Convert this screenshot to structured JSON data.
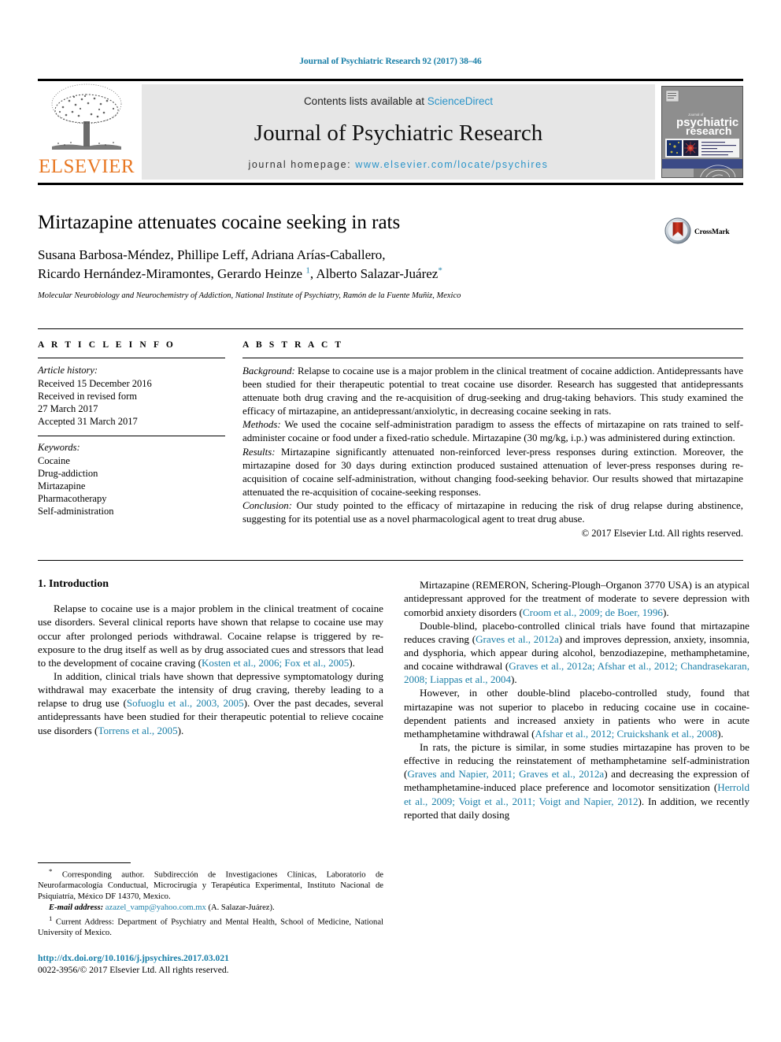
{
  "running_head": "Journal of Psychiatric Research 92 (2017) 38–46",
  "masthead": {
    "contents_prefix": "Contents lists available at ",
    "sciencedirect": "ScienceDirect",
    "journal_title": "Journal of Psychiatric Research",
    "homepage_label": "journal homepage: ",
    "homepage_url": "www.elsevier.com/locate/psychires",
    "publisher_logo_text": "ELSEVIER",
    "publisher_logo_icon": "elsevier-tree-icon",
    "cover_title_small": "Journal of",
    "cover_title_line1": "psychiatric",
    "cover_title_line2": "research",
    "accent_link_color": "#2a94c9",
    "elsevier_orange": "#E87722"
  },
  "article": {
    "title": "Mirtazapine attenuates cocaine seeking in rats",
    "authors_line1": "Susana Barbosa-Méndez, Phillipe Leff, Adriana Arías-Caballero,",
    "authors_line2_a": "Ricardo Hernández-Miramontes, Gerardo Heinze ",
    "authors_line2_mark1": "1",
    "authors_line2_b": ", Alberto Salazar-Juárez",
    "authors_line2_mark2": "*",
    "affiliation": "Molecular Neurobiology and Neurochemistry of Addiction, National Institute of Psychiatry, Ramón de la Fuente Muñiz, Mexico",
    "crossmark_label": "CrossMark",
    "crossmark_icon": "crossmark-icon"
  },
  "article_info": {
    "section_label": "A R T I C L E   I N F O",
    "history_head": "Article history:",
    "history": [
      "Received 15 December 2016",
      "Received in revised form",
      "27 March 2017",
      "Accepted 31 March 2017"
    ],
    "keywords_head": "Keywords:",
    "keywords": [
      "Cocaine",
      "Drug-addiction",
      "Mirtazapine",
      "Pharmacotherapy",
      "Self-administration"
    ]
  },
  "abstract": {
    "section_label": "A B S T R A C T",
    "background_label": "Background:",
    "background_text": " Relapse to cocaine use is a major problem in the clinical treatment of cocaine addiction. Antidepressants have been studied for their therapeutic potential to treat cocaine use disorder. Research has suggested that antidepressants attenuate both drug craving and the re-acquisition of drug-seeking and drug-taking behaviors. This study examined the efficacy of mirtazapine, an antidepressant/anxiolytic, in decreasing cocaine seeking in rats.",
    "methods_label": "Methods:",
    "methods_text": " We used the cocaine self-administration paradigm to assess the effects of mirtazapine on rats trained to self-administer cocaine or food under a fixed-ratio schedule. Mirtazapine (30 mg/kg, i.p.) was administered during extinction.",
    "results_label": "Results:",
    "results_text": " Mirtazapine significantly attenuated non-reinforced lever-press responses during extinction. Moreover, the mirtazapine dosed for 30 days during extinction produced sustained attenuation of lever-press responses during re-acquisition of cocaine self-administration, without changing food-seeking behavior. Our results showed that mirtazapine attenuated the re-acquisition of cocaine-seeking responses.",
    "conclusion_label": "Conclusion:",
    "conclusion_text": " Our study pointed to the efficacy of mirtazapine in reducing the risk of drug relapse during abstinence, suggesting for its potential use as a novel pharmacological agent to treat drug abuse.",
    "copyright": "© 2017 Elsevier Ltd. All rights reserved."
  },
  "introduction": {
    "heading": "1. Introduction",
    "left_para1_a": "Relapse to cocaine use is a major problem in the clinical treatment of cocaine use disorders. Several clinical reports have shown that relapse to cocaine use may occur after prolonged periods withdrawal. Cocaine relapse is triggered by re-exposure to the drug itself as well as by drug associated cues and stressors that lead to the development of cocaine craving (",
    "left_para1_ref": "Kosten et al., 2006; Fox et al., 2005",
    "left_para1_b": ").",
    "left_para2_a": "In addition, clinical trials have shown that depressive symptomatology during withdrawal may exacerbate the intensity of drug craving, thereby leading to a relapse to drug use (",
    "left_para2_ref1": "Sofuoglu et al., 2003, 2005",
    "left_para2_b": "). Over the past decades, several antidepressants have been studied for their therapeutic potential to relieve cocaine use disorders (",
    "left_para2_ref2": "Torrens et al., 2005",
    "left_para2_c": ").",
    "right_para1_a": "Mirtazapine (REMERON, Schering-Plough–Organon 3770 USA) is an atypical antidepressant approved for the treatment of moderate to severe depression with comorbid anxiety disorders (",
    "right_para1_ref": "Croom et al., 2009; de Boer, 1996",
    "right_para1_b": ").",
    "right_para2_a": "Double-blind, placebo-controlled clinical trials have found that mirtazapine reduces craving (",
    "right_para2_ref1": "Graves et al., 2012a",
    "right_para2_b": ") and improves depression, anxiety, insomnia, and dysphoria, which appear during alcohol, benzodiazepine, methamphetamine, and cocaine withdrawal (",
    "right_para2_ref2": "Graves et al., 2012a; Afshar et al., 2012; Chandrasekaran, 2008; Liappas et al., 2004",
    "right_para2_c": ").",
    "right_para3_a": "However, in other double-blind placebo-controlled study, found that mirtazapine was not superior to placebo in reducing cocaine use in cocaine-dependent patients and increased anxiety in patients who were in acute methamphetamine withdrawal (",
    "right_para3_ref": "Afshar et al., 2012; Cruickshank et al., 2008",
    "right_para3_b": ").",
    "right_para4_a": "In rats, the picture is similar, in some studies mirtazapine has proven to be effective in reducing the reinstatement of methamphetamine self-administration (",
    "right_para4_ref1": "Graves and Napier, 2011; Graves et al., 2012a",
    "right_para4_b": ") and decreasing the expression of methamphetamine-induced place preference and locomotor sensitization (",
    "right_para4_ref2": "Herrold et al., 2009; Voigt et al., 2011; Voigt and Napier, 2012",
    "right_para4_c": "). In addition, we recently reported that daily dosing"
  },
  "footnotes": {
    "corresponding_mark": "*",
    "corresponding_text": " Corresponding author. Subdirección de Investigaciones Clínicas, Laboratorio de Neurofarmacología Conductual, Microcirugía y Terapéutica Experimental, Instituto Nacional de Psiquiatría, México DF 14370, Mexico.",
    "email_label": "E-mail address:",
    "email_address": " azazel_vamp@yahoo.com.mx",
    "email_suffix": " (A. Salazar-Juárez).",
    "current_address_mark": "1",
    "current_address_text": " Current Address: Department of Psychiatry and Mental Health, School of Medicine, National University of Mexico.",
    "doi_url": "http://dx.doi.org/10.1016/j.jpsychires.2017.03.021",
    "issn_copyright": "0022-3956/© 2017 Elsevier Ltd. All rights reserved."
  }
}
